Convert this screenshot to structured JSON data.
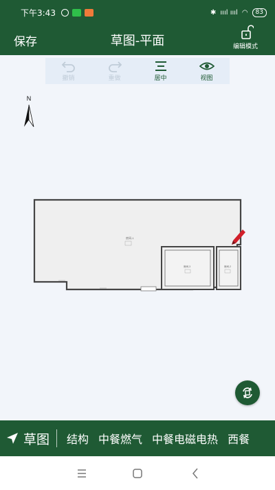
{
  "status_bar": {
    "time": "下午3:43",
    "signal": "ıııl ıııl",
    "battery": "83"
  },
  "header": {
    "save_label": "保存",
    "title": "草图-平面",
    "edit_mode_label": "编辑模式"
  },
  "toolbar": {
    "tools": [
      {
        "label": "撤销",
        "icon": "undo-icon"
      },
      {
        "label": "重做",
        "icon": "redo-icon"
      },
      {
        "label": "居中",
        "icon": "center-icon"
      },
      {
        "label": "视图",
        "icon": "eye-icon"
      }
    ]
  },
  "compass": {
    "north_label": "N"
  },
  "floorplan": {
    "rooms": [
      {
        "label": "房间-1"
      },
      {
        "label": "房间-3"
      },
      {
        "label": "房间-2"
      }
    ]
  },
  "bottom_bar": {
    "sketch_label": "草图",
    "categories": [
      "结构",
      "中餐燃气",
      "中餐电磁电热",
      "西餐"
    ]
  },
  "colors": {
    "brand_green": "#1f5a34",
    "canvas_bg": "#f2f5fa",
    "marker_red": "#d11f2a"
  }
}
